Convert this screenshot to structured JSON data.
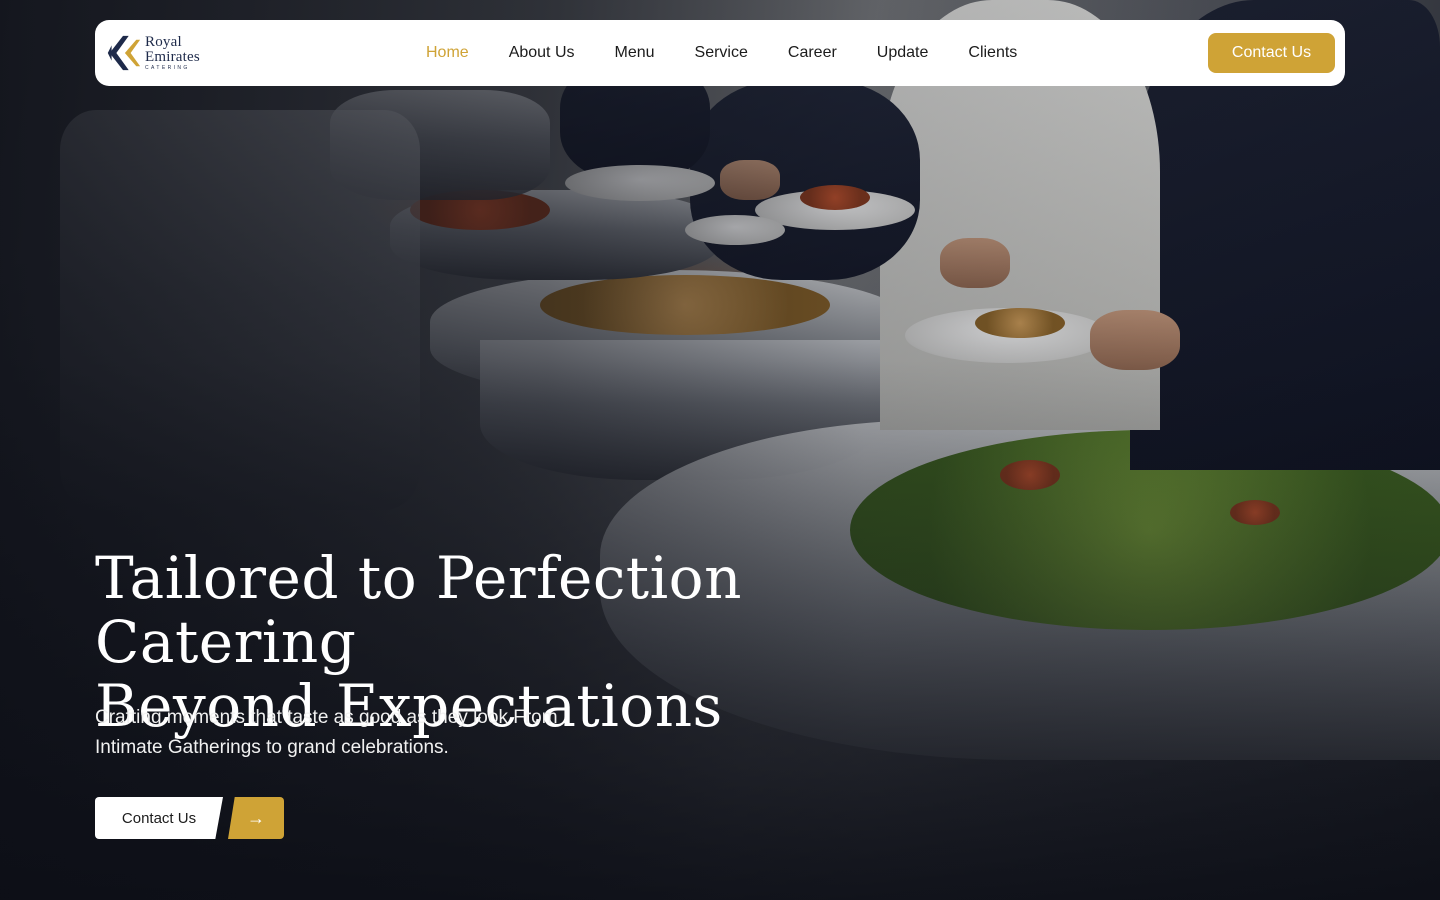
{
  "brand": {
    "name_line1": "Royal",
    "name_line2": "Emirates",
    "tagline": "CATERING",
    "colors": {
      "navy": "#1e2a4a",
      "gold": "#cfa336"
    }
  },
  "nav": {
    "items": [
      {
        "label": "Home",
        "active": true
      },
      {
        "label": "About Us",
        "active": false
      },
      {
        "label": "Menu",
        "active": false
      },
      {
        "label": "Service",
        "active": false
      },
      {
        "label": "Career",
        "active": false
      },
      {
        "label": "Update",
        "active": false
      },
      {
        "label": "Clients",
        "active": false
      }
    ],
    "contact_label": "Contact Us"
  },
  "hero": {
    "headline_line1": "Tailored to Perfection Catering",
    "headline_line2": "Beyond Expectations",
    "subtext_line1": "Crafting moments that taste as good as they look From",
    "subtext_line2": "Intimate Gatherings to grand celebrations.",
    "cta_label": "Contact Us",
    "cta_arrow": "→",
    "background_icon": "buffet-photo"
  }
}
